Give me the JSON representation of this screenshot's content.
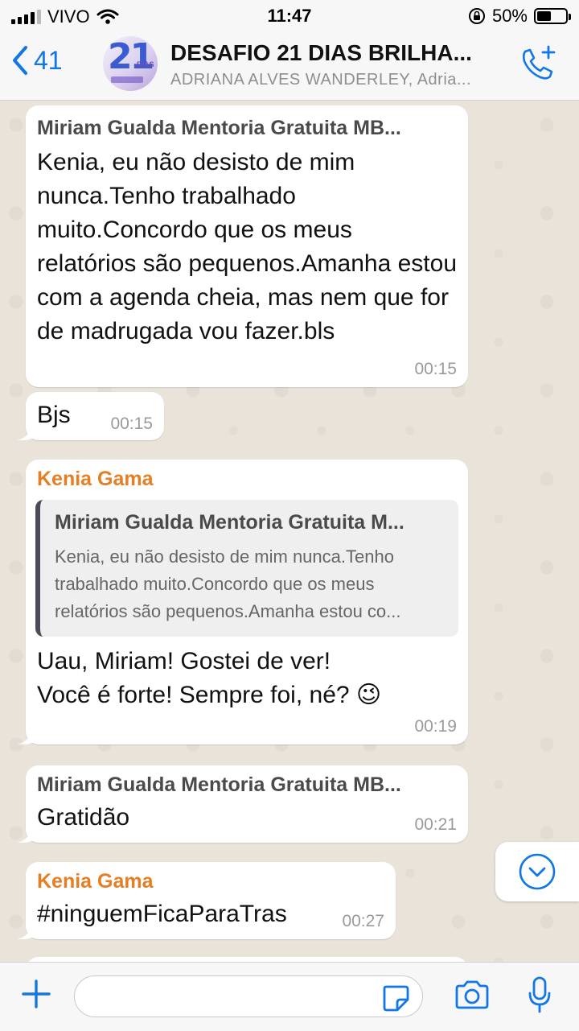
{
  "status_bar": {
    "carrier": "VIVO",
    "time": "11:47",
    "battery_percent": "50%",
    "battery_level": 0.5
  },
  "header": {
    "back_count": "41",
    "title": "DESAFIO 21 DIAS BRILHA...",
    "subtitle": "ADRIANA ALVES WANDERLEY, Adria...",
    "avatar_text": "21",
    "avatar_subtext": "DIAS"
  },
  "messages": [
    {
      "sender": "Miriam Gualda Mentoria Gratuita MB...",
      "text": "Kenia,  eu não desisto de mim nunca.Tenho trabalhado muito.Concordo que os meus relatórios são pequenos.Amanha estou com a agenda cheia, mas nem que for de madrugada vou fazer.bls",
      "time": "00:15"
    },
    {
      "sender": "",
      "text": "Bjs",
      "time": "00:15"
    },
    {
      "sender": "Kenia Gama",
      "quote_sender": "Miriam Gualda Mentoria Gratuita M...",
      "quote_text": "Kenia,  eu não desisto de mim nunca.Tenho trabalhado muito.Concordo que os meus relatórios são pequenos.Amanha estou co...",
      "text_line1": "Uau, Miriam! Gostei de ver!",
      "text_line2": "Você é forte! Sempre foi, né? 😉",
      "time": "00:19"
    },
    {
      "sender": "Miriam Gualda Mentoria Gratuita MB...",
      "text": "Gratidão",
      "time": "00:21"
    },
    {
      "sender": "Kenia Gama",
      "text": "#ninguemFicaParaTras",
      "time": "00:27"
    }
  ],
  "input": {
    "placeholder": "",
    "value": ""
  },
  "colors": {
    "accent": "#1277e6",
    "kenia_name": "#e67e22",
    "chat_background": "#e9e3da"
  },
  "icons": [
    "chevron-left-icon",
    "add-call-icon",
    "chevron-down-icon",
    "plus-icon",
    "sticker-icon",
    "camera-icon",
    "microphone-icon"
  ]
}
